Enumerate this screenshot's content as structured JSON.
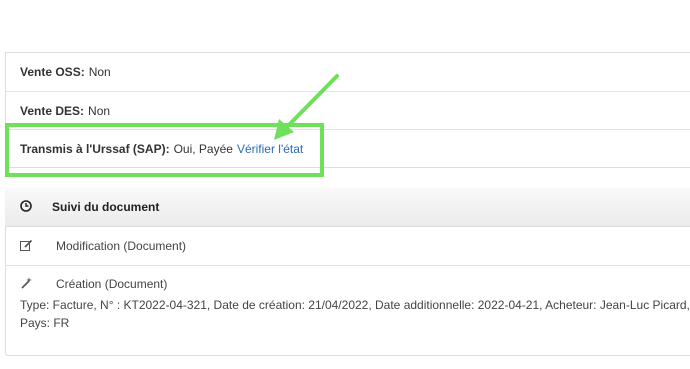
{
  "info_rows": {
    "oss": {
      "label": "Vente OSS:",
      "value": "Non"
    },
    "des": {
      "label": "Vente DES:",
      "value": "Non"
    },
    "urssaf": {
      "label": "Transmis à l'Urssaf (SAP):",
      "value": "Oui, Payée",
      "link": "Vérifier l'état"
    }
  },
  "suivi": {
    "title": "Suivi du document",
    "icon": "clock-icon",
    "entries": [
      {
        "icon": "pencil-icon",
        "title": "Modification (Document)"
      },
      {
        "icon": "wand-icon",
        "title": "Création (Document)",
        "detail_line1": "Type: Facture, N° : KT2022-04-321, Date de création: 21/04/2022, Date additionnelle: 2022-04-21, Acheteur: Jean-Luc Picard,",
        "detail_line2": "Pays: FR"
      }
    ]
  },
  "annotation": {
    "color": "#6ee05a"
  }
}
